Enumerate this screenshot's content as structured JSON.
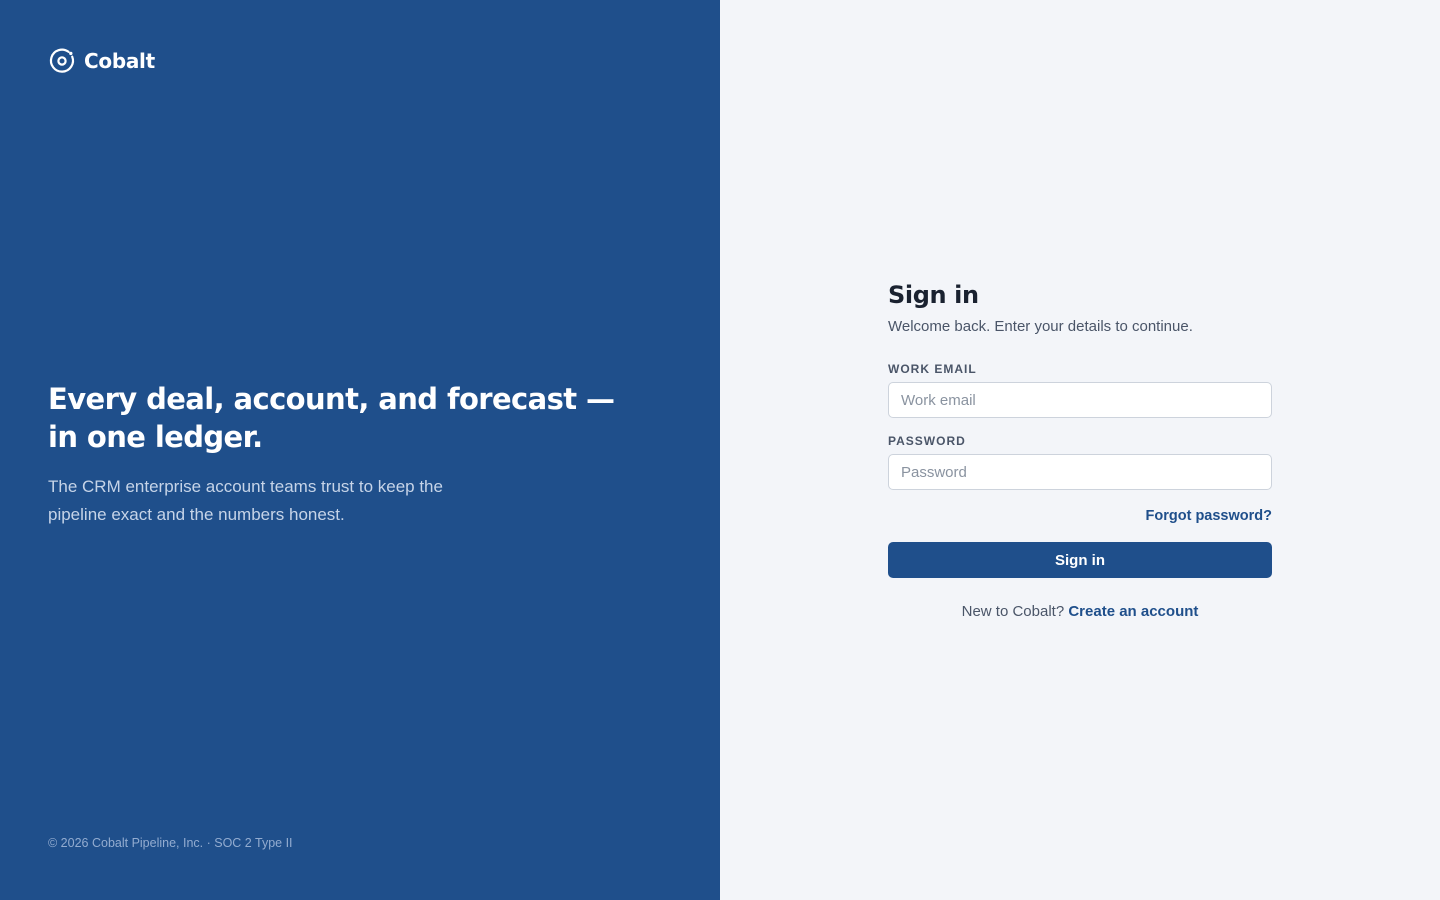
{
  "brand": {
    "name": "Cobalt",
    "logo_icon": "orbit-icon",
    "colors": {
      "primary": "#1f4f8b",
      "background": "#f3f5f9"
    }
  },
  "hero": {
    "title": "Every deal, account, and forecast — in one ledger.",
    "subtitle": "The CRM enterprise account teams trust to keep the pipeline exact and the numbers honest."
  },
  "footer": {
    "note": "© 2026 Cobalt Pipeline, Inc. · SOC 2 Type II"
  },
  "signin": {
    "title": "Sign in",
    "subtitle": "Welcome back. Enter your details to continue.",
    "email_label": "WORK EMAIL",
    "email_placeholder": "Work email",
    "email_value": "",
    "password_label": "PASSWORD",
    "password_placeholder": "Password",
    "password_value": "",
    "forgot_label": "Forgot password?",
    "submit_label": "Sign in",
    "signup_prompt": "New to Cobalt?",
    "signup_link": "Create an account"
  }
}
